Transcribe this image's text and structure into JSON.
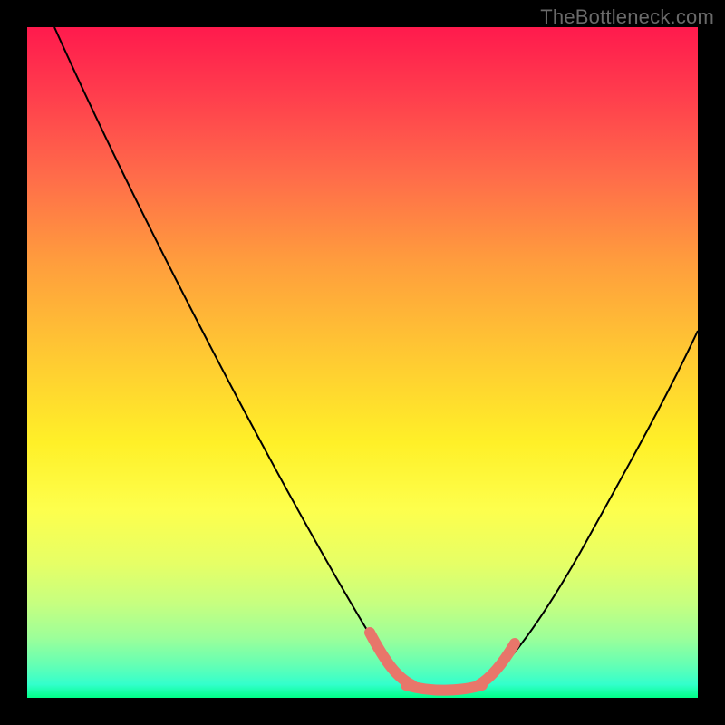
{
  "watermark": "TheBottleneck.com",
  "chart_data": {
    "type": "line",
    "title": "",
    "xlabel": "",
    "ylabel": "",
    "xlim": [
      0,
      100
    ],
    "ylim": [
      0,
      100
    ],
    "series": [
      {
        "name": "curve",
        "x": [
          4,
          10,
          20,
          30,
          40,
          48,
          53,
          56,
          60,
          64,
          67,
          70,
          75,
          80,
          85,
          90,
          95,
          100
        ],
        "values": [
          100,
          89,
          72,
          55,
          37,
          22,
          12,
          6,
          2,
          1,
          1,
          2,
          6,
          13,
          22,
          32,
          43,
          55
        ]
      }
    ],
    "highlight_segment": {
      "name": "near-zero-band",
      "x": [
        53,
        56,
        60,
        64,
        67,
        70
      ],
      "values": [
        12,
        6,
        2,
        1,
        1,
        2
      ]
    },
    "background_gradient": {
      "top": "#ff1a4d",
      "mid": "#ffd633",
      "bottom": "#00ff88"
    }
  }
}
